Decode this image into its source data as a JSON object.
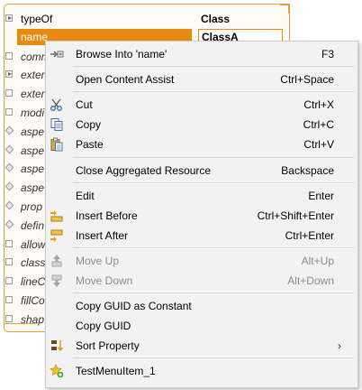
{
  "properties": {
    "rows": [
      {
        "label": "typeOf",
        "value": "Class",
        "marker": "expander",
        "style": "plain"
      },
      {
        "label": "name",
        "value": "ClassA",
        "marker": "none",
        "style": "selected"
      },
      {
        "label": "comm",
        "value": "",
        "marker": "square",
        "style": "italic"
      },
      {
        "label": "exter",
        "value": "",
        "marker": "expander",
        "style": "italic"
      },
      {
        "label": "exter",
        "value": "",
        "marker": "square",
        "style": "italic"
      },
      {
        "label": "modi",
        "value": "",
        "marker": "square",
        "style": "italic"
      },
      {
        "label": "aspe",
        "value": "",
        "marker": "diamond",
        "style": "italic"
      },
      {
        "label": "aspe",
        "value": "",
        "marker": "diamond",
        "style": "italic"
      },
      {
        "label": "aspe",
        "value": "",
        "marker": "diamond",
        "style": "italic"
      },
      {
        "label": "aspe",
        "value": "",
        "marker": "diamond",
        "style": "italic"
      },
      {
        "label": "prop",
        "value": "",
        "marker": "diamond",
        "style": "italic"
      },
      {
        "label": "defin",
        "value": "",
        "marker": "diamond",
        "style": "italic"
      },
      {
        "label": "allow",
        "value": "",
        "marker": "square",
        "style": "italic"
      },
      {
        "label": "class",
        "value": "",
        "marker": "square",
        "style": "italic"
      },
      {
        "label": "lineC",
        "value": "",
        "marker": "square",
        "style": "italic"
      },
      {
        "label": "fillCo",
        "value": "",
        "marker": "square",
        "style": "italic"
      },
      {
        "label": "shap",
        "value": "",
        "marker": "square",
        "style": "italic"
      }
    ]
  },
  "menu": {
    "items": [
      {
        "label": "Browse Into 'name'",
        "shortcut": "F3",
        "icon": "browse-into-icon",
        "enabled": true,
        "submenu": false
      },
      {
        "separator": true
      },
      {
        "label": "Open Content Assist",
        "shortcut": "Ctrl+Space",
        "icon": "",
        "enabled": true,
        "submenu": false
      },
      {
        "separator": true
      },
      {
        "label": "Cut",
        "shortcut": "Ctrl+X",
        "icon": "scissors-icon",
        "enabled": true,
        "submenu": false
      },
      {
        "label": "Copy",
        "shortcut": "Ctrl+C",
        "icon": "copy-icon",
        "enabled": true,
        "submenu": false
      },
      {
        "label": "Paste",
        "shortcut": "Ctrl+V",
        "icon": "paste-icon",
        "enabled": true,
        "submenu": false
      },
      {
        "separator": true
      },
      {
        "label": "Close Aggregated Resource",
        "shortcut": "Backspace",
        "icon": "",
        "enabled": true,
        "submenu": false
      },
      {
        "separator": true
      },
      {
        "label": "Edit",
        "shortcut": "Enter",
        "icon": "",
        "enabled": true,
        "submenu": false
      },
      {
        "label": "Insert Before",
        "shortcut": "Ctrl+Shift+Enter",
        "icon": "insert-before-icon",
        "enabled": true,
        "submenu": false
      },
      {
        "label": "Insert After",
        "shortcut": "Ctrl+Enter",
        "icon": "insert-after-icon",
        "enabled": true,
        "submenu": false
      },
      {
        "separator": true
      },
      {
        "label": "Move Up",
        "shortcut": "Alt+Up",
        "icon": "move-up-icon",
        "enabled": false,
        "submenu": false
      },
      {
        "label": "Move Down",
        "shortcut": "Alt+Down",
        "icon": "move-down-icon",
        "enabled": false,
        "submenu": false
      },
      {
        "separator": true
      },
      {
        "label": "Copy GUID as Constant",
        "shortcut": "",
        "icon": "",
        "enabled": true,
        "submenu": false
      },
      {
        "label": "Copy GUID",
        "shortcut": "",
        "icon": "",
        "enabled": true,
        "submenu": false
      },
      {
        "label": "Sort Property",
        "shortcut": "",
        "icon": "sort-property-icon",
        "enabled": true,
        "submenu": true
      },
      {
        "separator": true
      },
      {
        "label": "TestMenuItem_1",
        "shortcut": "",
        "icon": "star-add-icon",
        "enabled": true,
        "submenu": false
      }
    ],
    "submenu_glyph": "›"
  },
  "colors": {
    "panel_border": "#e0a040",
    "selection": "#e98a10",
    "menu_bg": "#f2f2f2",
    "disabled_text": "#8d8d8d"
  }
}
